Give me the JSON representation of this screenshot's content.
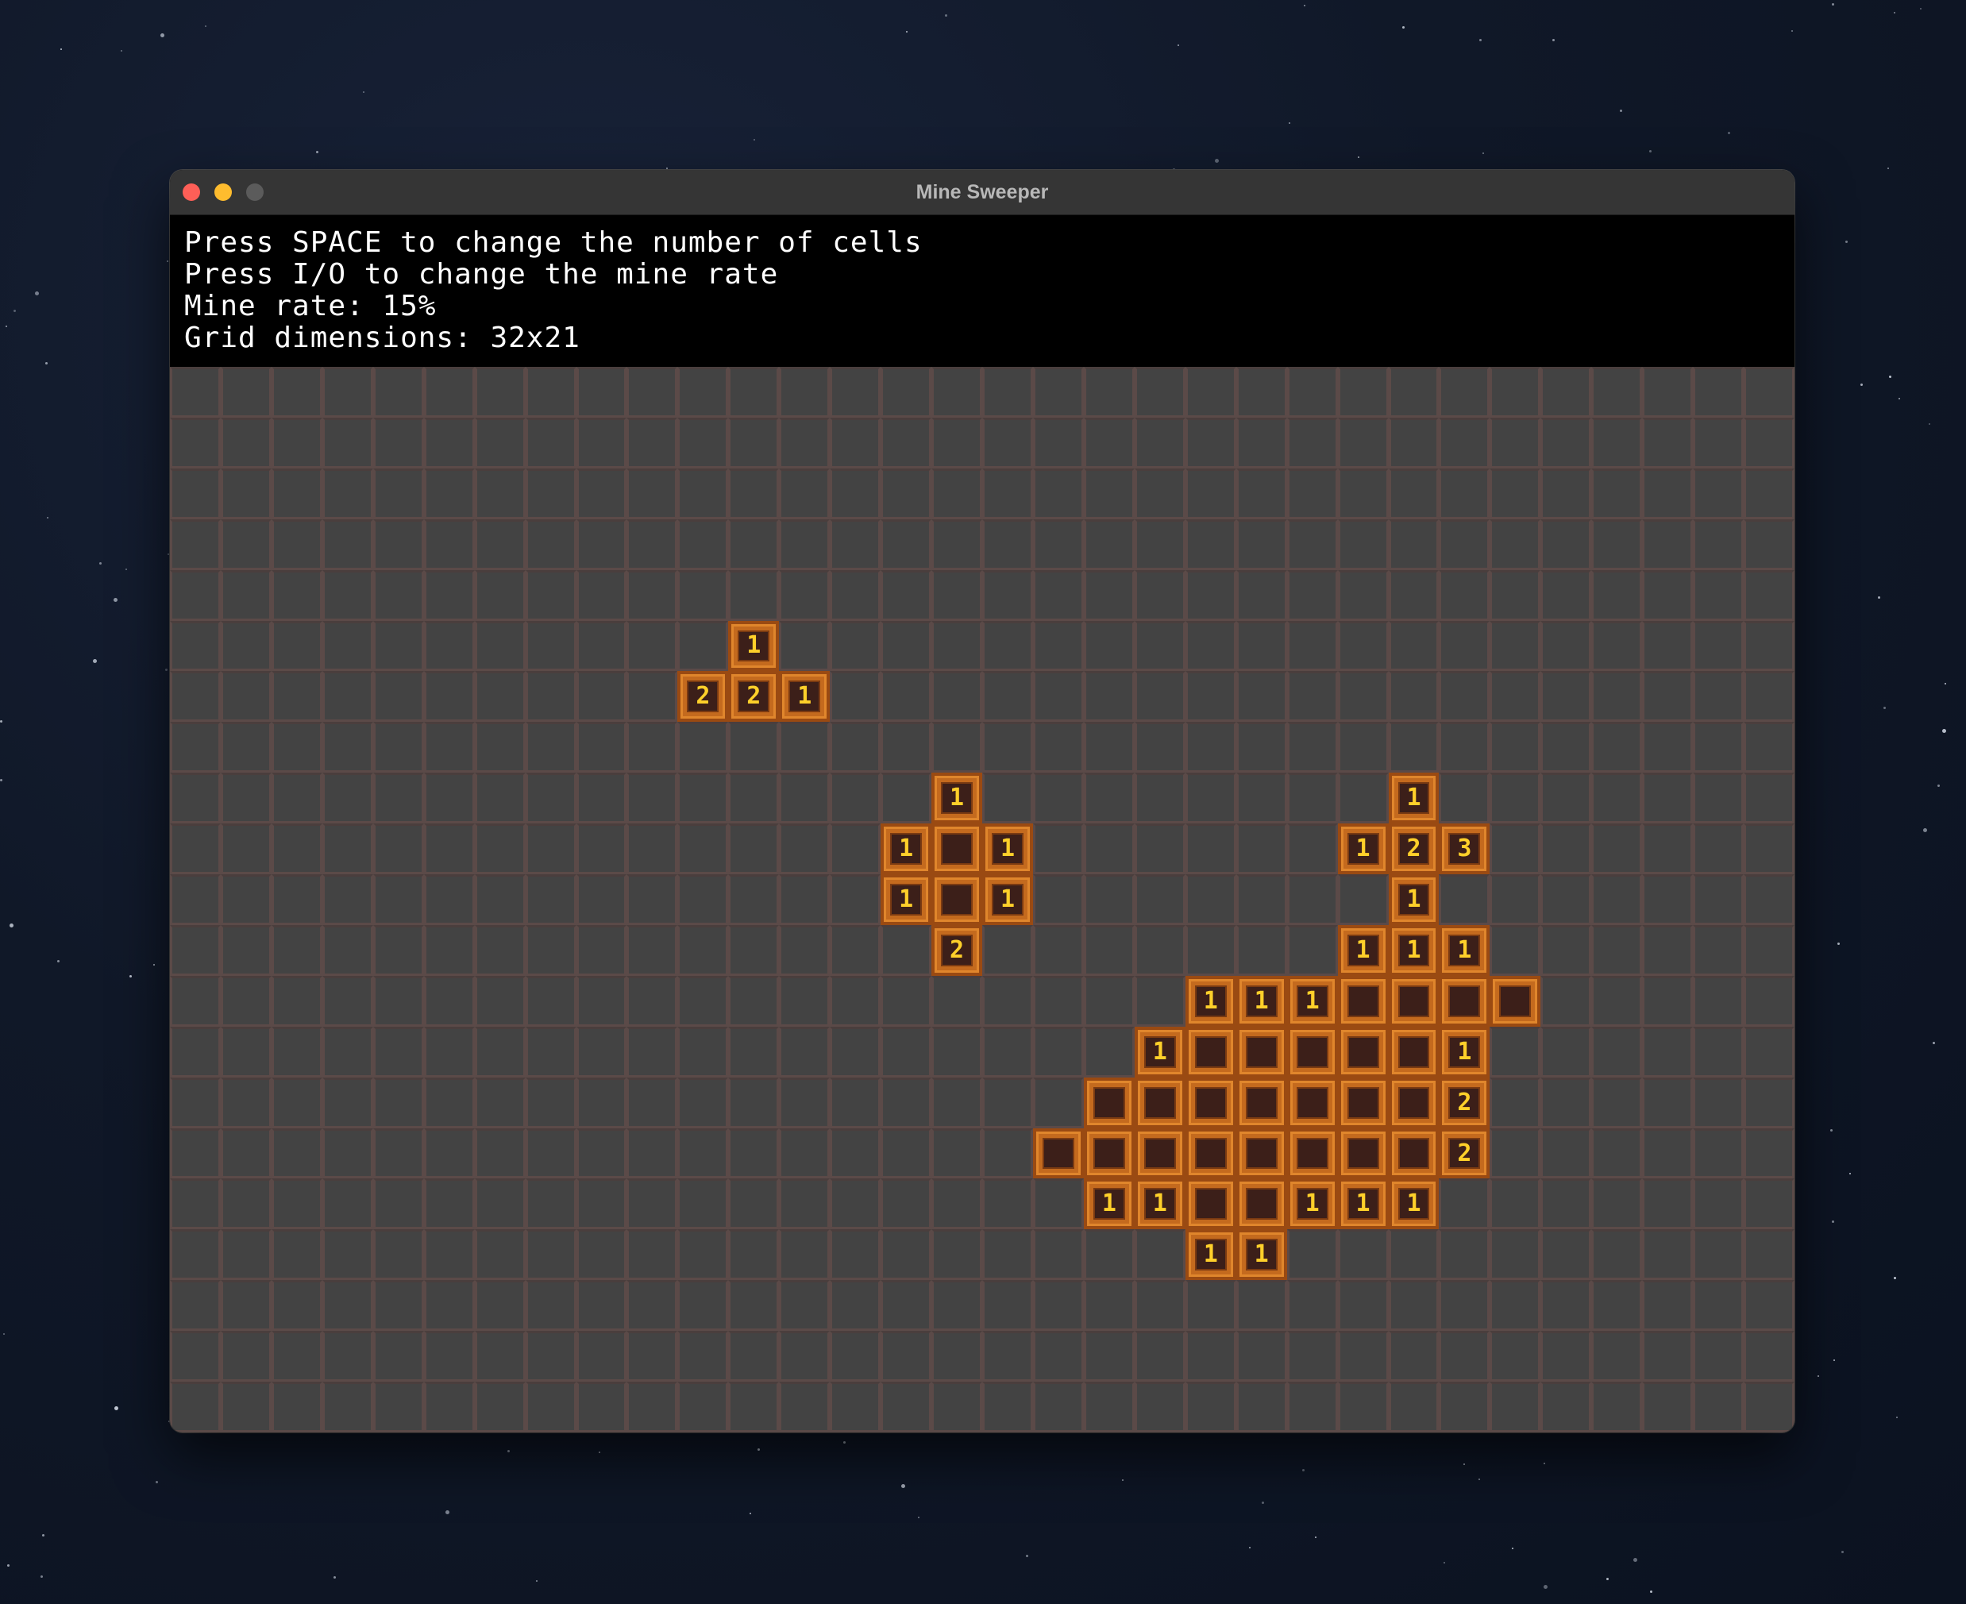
{
  "window": {
    "title": "Mine Sweeper"
  },
  "info": {
    "line_space": "Press SPACE to change the number of cells",
    "line_rate": "Press I/O to change the mine rate",
    "mine_rate": "Mine rate: 15%",
    "grid_dims": "Grid dimensions: 32x21"
  },
  "grid": {
    "cols": 32,
    "rows": 21,
    "open_cells": [
      {
        "r": 5,
        "c": 11,
        "v": "1"
      },
      {
        "r": 6,
        "c": 10,
        "v": "2"
      },
      {
        "r": 6,
        "c": 11,
        "v": "2"
      },
      {
        "r": 6,
        "c": 12,
        "v": "1"
      },
      {
        "r": 8,
        "c": 15,
        "v": "1"
      },
      {
        "r": 8,
        "c": 24,
        "v": "1"
      },
      {
        "r": 9,
        "c": 14,
        "v": "1"
      },
      {
        "r": 9,
        "c": 15,
        "v": ""
      },
      {
        "r": 9,
        "c": 16,
        "v": "1"
      },
      {
        "r": 9,
        "c": 23,
        "v": "1"
      },
      {
        "r": 9,
        "c": 24,
        "v": "2"
      },
      {
        "r": 9,
        "c": 25,
        "v": "3"
      },
      {
        "r": 10,
        "c": 14,
        "v": "1"
      },
      {
        "r": 10,
        "c": 15,
        "v": ""
      },
      {
        "r": 10,
        "c": 16,
        "v": "1"
      },
      {
        "r": 10,
        "c": 24,
        "v": "1"
      },
      {
        "r": 11,
        "c": 15,
        "v": "2"
      },
      {
        "r": 11,
        "c": 23,
        "v": "1"
      },
      {
        "r": 11,
        "c": 24,
        "v": "1"
      },
      {
        "r": 11,
        "c": 25,
        "v": "1"
      },
      {
        "r": 12,
        "c": 20,
        "v": "1"
      },
      {
        "r": 12,
        "c": 21,
        "v": "1"
      },
      {
        "r": 12,
        "c": 22,
        "v": "1"
      },
      {
        "r": 12,
        "c": 23,
        "v": ""
      },
      {
        "r": 12,
        "c": 24,
        "v": ""
      },
      {
        "r": 12,
        "c": 25,
        "v": ""
      },
      {
        "r": 12,
        "c": 26,
        "v": ""
      },
      {
        "r": 13,
        "c": 19,
        "v": "1"
      },
      {
        "r": 13,
        "c": 20,
        "v": ""
      },
      {
        "r": 13,
        "c": 21,
        "v": ""
      },
      {
        "r": 13,
        "c": 22,
        "v": ""
      },
      {
        "r": 13,
        "c": 23,
        "v": ""
      },
      {
        "r": 13,
        "c": 24,
        "v": ""
      },
      {
        "r": 13,
        "c": 25,
        "v": "1"
      },
      {
        "r": 14,
        "c": 18,
        "v": ""
      },
      {
        "r": 14,
        "c": 19,
        "v": ""
      },
      {
        "r": 14,
        "c": 20,
        "v": ""
      },
      {
        "r": 14,
        "c": 21,
        "v": ""
      },
      {
        "r": 14,
        "c": 22,
        "v": ""
      },
      {
        "r": 14,
        "c": 23,
        "v": ""
      },
      {
        "r": 14,
        "c": 24,
        "v": ""
      },
      {
        "r": 14,
        "c": 25,
        "v": "2"
      },
      {
        "r": 15,
        "c": 17,
        "v": ""
      },
      {
        "r": 15,
        "c": 18,
        "v": ""
      },
      {
        "r": 15,
        "c": 19,
        "v": ""
      },
      {
        "r": 15,
        "c": 20,
        "v": ""
      },
      {
        "r": 15,
        "c": 21,
        "v": ""
      },
      {
        "r": 15,
        "c": 22,
        "v": ""
      },
      {
        "r": 15,
        "c": 23,
        "v": ""
      },
      {
        "r": 15,
        "c": 24,
        "v": ""
      },
      {
        "r": 15,
        "c": 25,
        "v": "2"
      },
      {
        "r": 16,
        "c": 18,
        "v": "1"
      },
      {
        "r": 16,
        "c": 19,
        "v": "1"
      },
      {
        "r": 16,
        "c": 20,
        "v": ""
      },
      {
        "r": 16,
        "c": 21,
        "v": ""
      },
      {
        "r": 16,
        "c": 22,
        "v": "1"
      },
      {
        "r": 16,
        "c": 23,
        "v": "1"
      },
      {
        "r": 16,
        "c": 24,
        "v": "1"
      },
      {
        "r": 17,
        "c": 20,
        "v": "1"
      },
      {
        "r": 17,
        "c": 21,
        "v": "1"
      }
    ]
  }
}
